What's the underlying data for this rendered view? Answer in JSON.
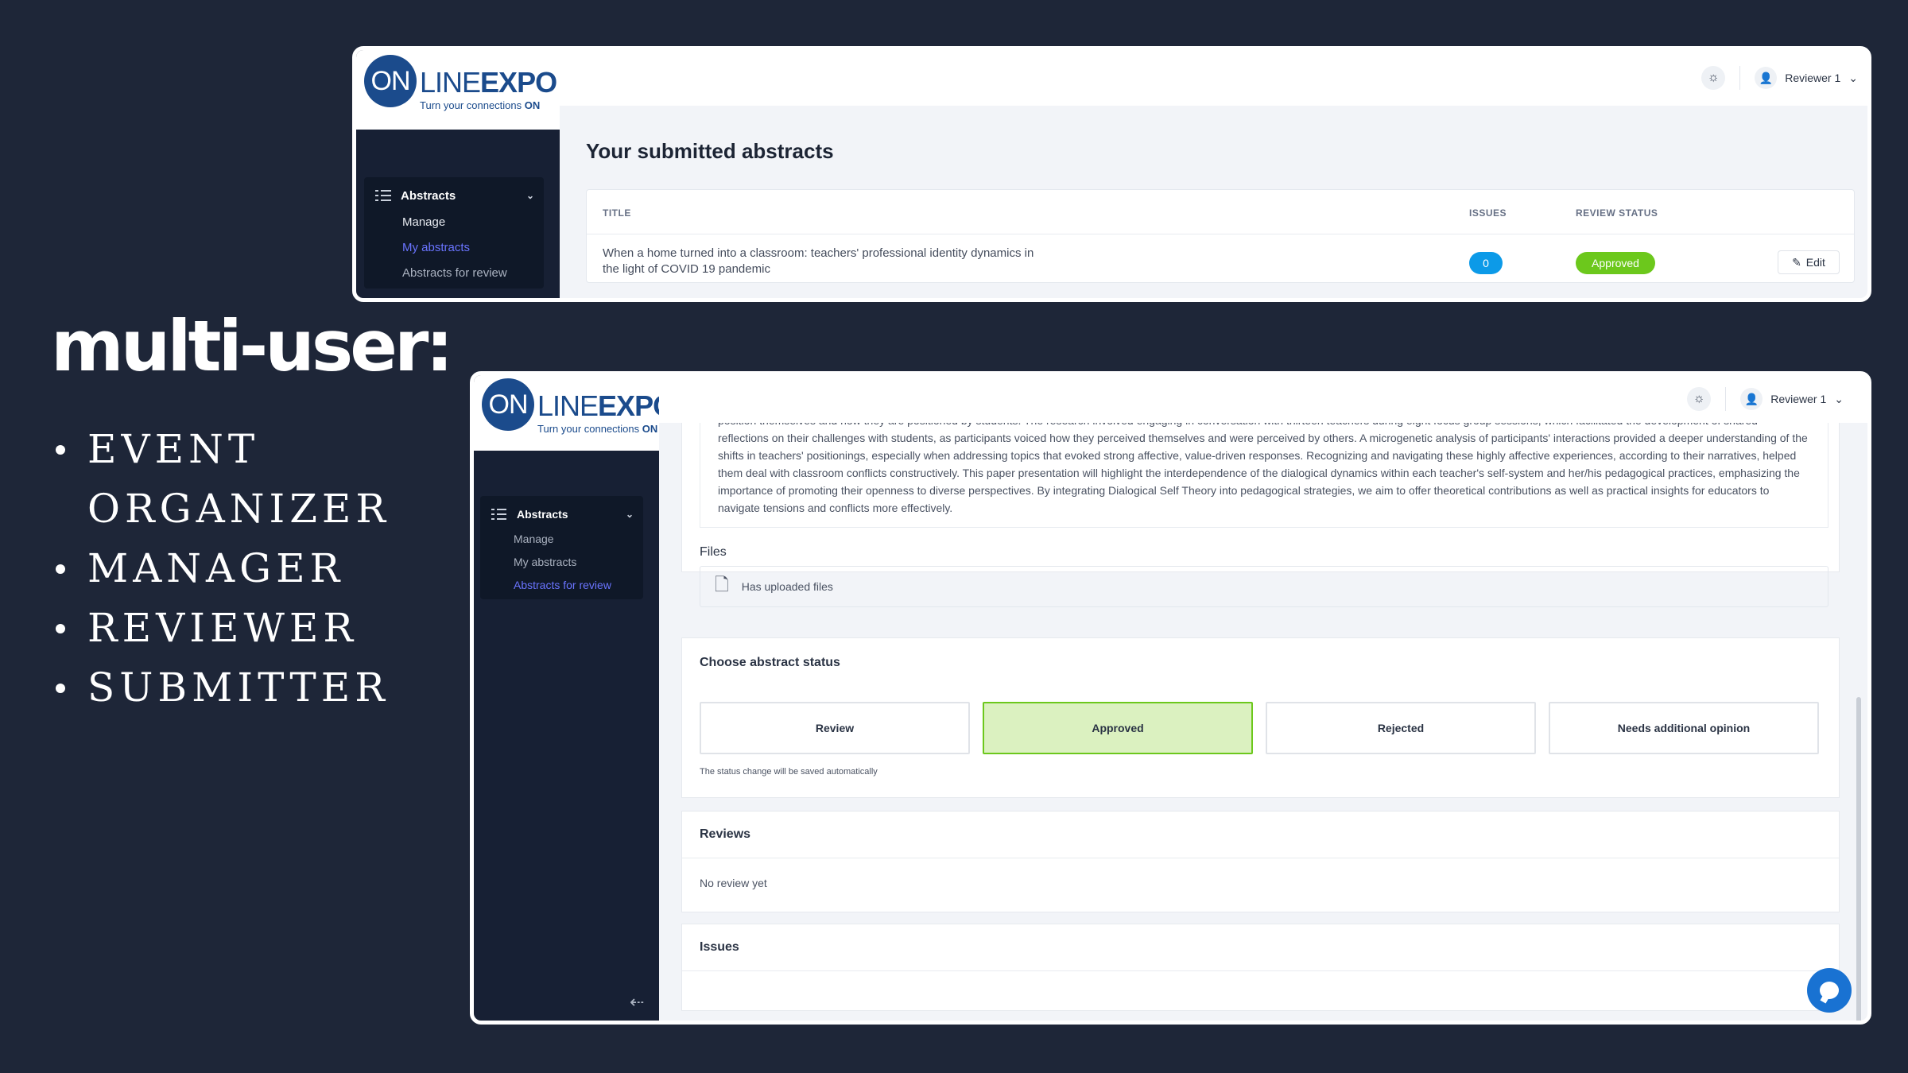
{
  "headline": "multi-user:",
  "roles": [
    "EVENT ORGANIZER",
    "MANAGER",
    "REVIEWER",
    "SUBMITTER"
  ],
  "logo": {
    "on": "ON",
    "line": "LINE",
    "expo": "EXPO",
    "tagline": "Turn your connections ",
    "tagline_bold": "ON"
  },
  "user": {
    "name": "Reviewer 1"
  },
  "sidebar": {
    "section": "Abstracts",
    "items": [
      "Manage",
      "My abstracts",
      "Abstracts for review"
    ]
  },
  "window1": {
    "page_title": "Your submitted abstracts",
    "columns": [
      "TITLE",
      "ISSUES",
      "REVIEW STATUS"
    ],
    "row": {
      "title": "When a home turned into a classroom: teachers' professional identity dynamics in the light of COVID 19 pandemic",
      "issues": "0",
      "status": "Approved",
      "edit": "Edit"
    }
  },
  "window2": {
    "abstract_text": "position themselves and how they are positioned by students. The research involved engaging in conversation with thirteen teachers during eight focus group sessions, which facilitated the development of shared reflections on their challenges with students, as participants voiced how they perceived themselves and were perceived by others. A microgenetic analysis of participants' interactions provided a deeper understanding of the shifts in teachers' positionings, especially when addressing topics that evoked strong affective, value-driven responses. Recognizing and navigating these highly affective experiences, according to their narratives, helped them deal with classroom conflicts constructively. This paper presentation will highlight the interdependence of the dialogical dynamics within each teacher's self-system and her/his pedagogical practices, emphasizing the importance of promoting their openness to diverse perspectives. By integrating Dialogical Self Theory into pedagogical strategies, we aim to offer theoretical contributions as well as practical insights for educators to navigate tensions and conflicts more effectively.",
    "files_label": "Files",
    "files_value": "Has uploaded files",
    "status_title": "Choose abstract status",
    "status_options": [
      "Review",
      "Approved",
      "Rejected",
      "Needs additional opinion"
    ],
    "status_hint": "The status change will be saved automatically",
    "reviews_title": "Reviews",
    "reviews_empty": "No review yet",
    "issues_title": "Issues"
  },
  "colors": {
    "background": "#1e2638",
    "sidebar": "#172034",
    "accent": "#6a74ff",
    "approved": "#6cc81c",
    "count_badge": "#0c9ae8"
  }
}
